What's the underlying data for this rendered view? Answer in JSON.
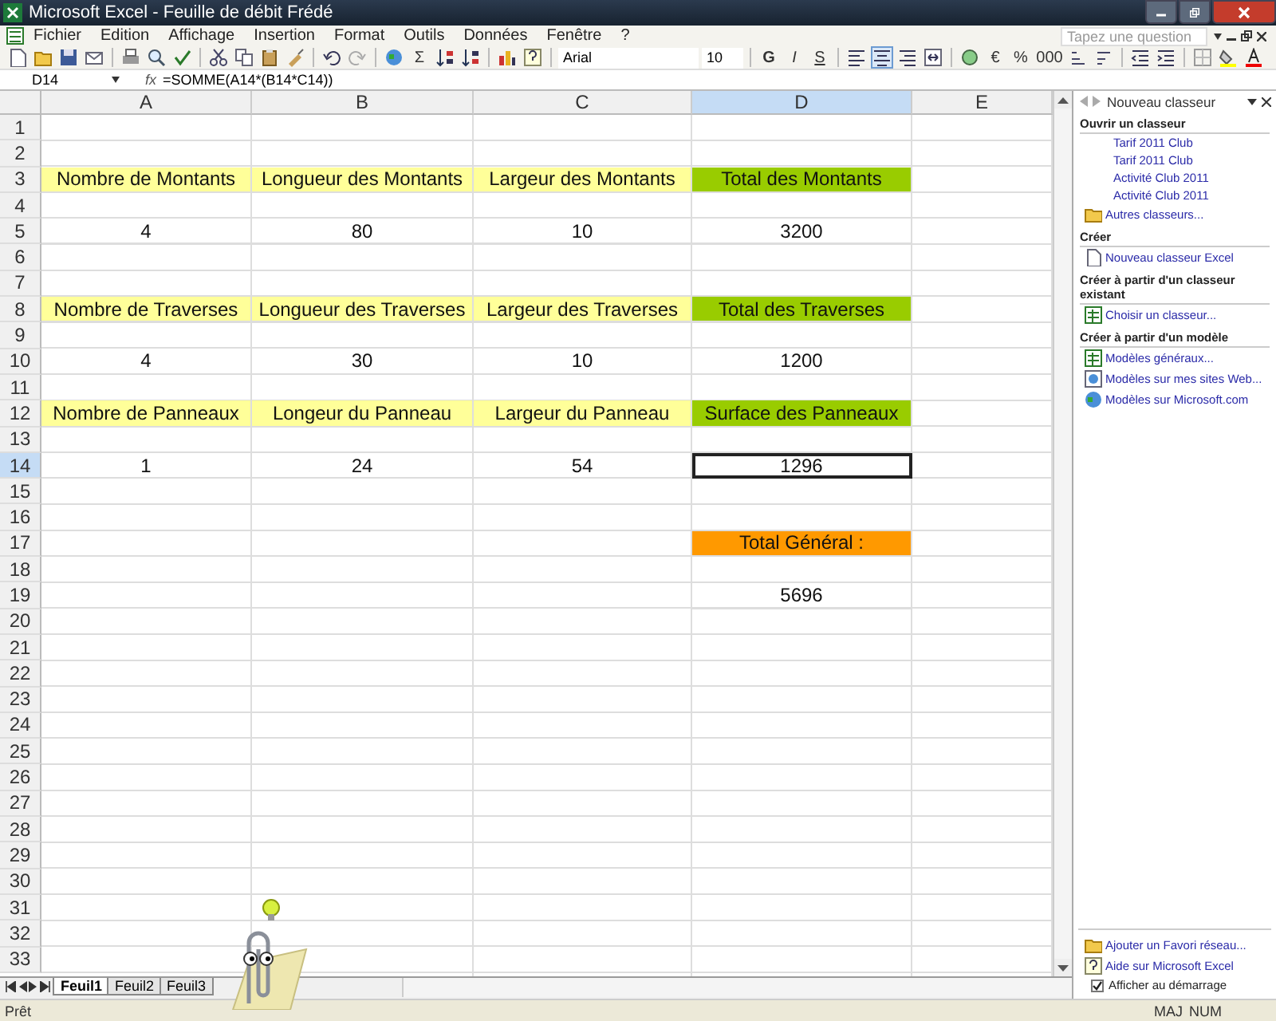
{
  "window": {
    "title": "Microsoft Excel - Feuille de débit Frédé"
  },
  "menu": [
    "Fichier",
    "Edition",
    "Affichage",
    "Insertion",
    "Format",
    "Outils",
    "Données",
    "Fenêtre",
    "?"
  ],
  "help_search": {
    "placeholder": "Tapez une question"
  },
  "toolbar": {
    "sum_button": "Σ",
    "font": "Arial",
    "size": "10",
    "style_buttons": [
      "G",
      "I",
      "S"
    ],
    "alignment_buttons": [
      {
        "selected": false
      },
      {
        "selected": true
      },
      {
        "selected": false
      }
    ],
    "number_buttons": [
      "€",
      "%",
      "000"
    ]
  },
  "formula_bar": {
    "name_box": "D14",
    "fx": "fx",
    "formula": "=SOMME(A14*(B14*C14))"
  },
  "sheet": {
    "columns": [
      {
        "label": "A",
        "selected": false
      },
      {
        "label": "B",
        "selected": false
      },
      {
        "label": "C",
        "selected": false
      },
      {
        "label": "D",
        "selected": true
      },
      {
        "label": "E",
        "selected": false
      }
    ],
    "rows": [
      {
        "label": "1",
        "selected": false
      },
      {
        "label": "2",
        "selected": false
      },
      {
        "label": "3",
        "selected": false,
        "cells": [
          {
            "text": "Nombre de Montants",
            "color": "#ffff99",
            "selected": false
          },
          {
            "text": "Longueur des Montants",
            "color": "#ffff99",
            "selected": false
          },
          {
            "text": "Largeur des Montants",
            "color": "#ffff99",
            "selected": false
          },
          {
            "text": "Total des Montants",
            "color": "#99cc00",
            "selected": false
          }
        ]
      },
      {
        "label": "4",
        "selected": false
      },
      {
        "label": "5",
        "selected": false,
        "cells": [
          {
            "text": "4",
            "selected": false
          },
          {
            "text": "80",
            "selected": false
          },
          {
            "text": "10",
            "selected": false
          },
          {
            "text": "3200",
            "selected": false
          }
        ]
      },
      {
        "label": "6",
        "selected": false
      },
      {
        "label": "7",
        "selected": false
      },
      {
        "label": "8",
        "selected": false,
        "cells": [
          {
            "text": "Nombre de Traverses",
            "color": "#ffff99",
            "selected": false
          },
          {
            "text": "Longueur des Traverses",
            "color": "#ffff99",
            "selected": false
          },
          {
            "text": "Largeur des Traverses",
            "color": "#ffff99",
            "selected": false
          },
          {
            "text": "Total des Traverses",
            "color": "#99cc00",
            "selected": false
          }
        ]
      },
      {
        "label": "9",
        "selected": false
      },
      {
        "label": "10",
        "selected": false,
        "cells": [
          {
            "text": "4",
            "selected": false
          },
          {
            "text": "30",
            "selected": false
          },
          {
            "text": "10",
            "selected": false
          },
          {
            "text": "1200",
            "selected": false
          }
        ]
      },
      {
        "label": "11",
        "selected": false
      },
      {
        "label": "12",
        "selected": false,
        "cells": [
          {
            "text": "Nombre de Panneaux",
            "color": "#ffff99",
            "selected": false
          },
          {
            "text": "Longeur du Panneau",
            "color": "#ffff99",
            "selected": false
          },
          {
            "text": "Largeur du Panneau",
            "color": "#ffff99",
            "selected": false
          },
          {
            "text": "Surface des Panneaux",
            "color": "#99cc00",
            "selected": false
          }
        ]
      },
      {
        "label": "13",
        "selected": false
      },
      {
        "label": "14",
        "selected": true,
        "cells": [
          {
            "text": "1",
            "selected": false
          },
          {
            "text": "24",
            "selected": false
          },
          {
            "text": "54",
            "selected": false
          },
          {
            "text": "1296",
            "selected": true
          }
        ]
      },
      {
        "label": "15",
        "selected": false
      },
      {
        "label": "16",
        "selected": false
      },
      {
        "label": "17",
        "selected": false,
        "cells": [
          null,
          null,
          null,
          {
            "text": "Total Général :",
            "color": "#ff9900",
            "selected": false
          }
        ]
      },
      {
        "label": "18",
        "selected": false
      },
      {
        "label": "19",
        "selected": false,
        "cells": [
          null,
          null,
          null,
          {
            "text": "5696",
            "selected": false
          }
        ]
      },
      {
        "label": "20",
        "selected": false
      },
      {
        "label": "21",
        "selected": false
      },
      {
        "label": "22",
        "selected": false
      },
      {
        "label": "23",
        "selected": false
      },
      {
        "label": "24",
        "selected": false
      },
      {
        "label": "25",
        "selected": false
      },
      {
        "label": "26",
        "selected": false
      },
      {
        "label": "27",
        "selected": false
      },
      {
        "label": "28",
        "selected": false
      },
      {
        "label": "29",
        "selected": false
      },
      {
        "label": "30",
        "selected": false
      },
      {
        "label": "31",
        "selected": false
      },
      {
        "label": "32",
        "selected": false
      },
      {
        "label": "33",
        "selected": false
      }
    ]
  },
  "sheet_tabs": [
    {
      "label": "Feuil1",
      "selected": true
    },
    {
      "label": "Feuil2",
      "selected": false
    },
    {
      "label": "Feuil3",
      "selected": false
    }
  ],
  "status_bar": {
    "status": "Prêt",
    "indicators": [
      "MAJ",
      "NUM"
    ]
  },
  "task_pane": {
    "title": "Nouveau classeur",
    "sections": [
      {
        "title": "Ouvrir un classeur",
        "items": [
          {
            "label": "Tarif 2011 Club",
            "kind": "plain"
          },
          {
            "label": "Tarif 2011 Club",
            "kind": "plain"
          },
          {
            "label": "Activité Club 2011",
            "kind": "plain"
          },
          {
            "label": "Activité Club 2011",
            "kind": "plain"
          },
          {
            "label": "Autres classeurs...",
            "kind": "folder"
          }
        ]
      },
      {
        "title": "Créer",
        "items": [
          {
            "label": "Nouveau classeur Excel",
            "kind": "page"
          }
        ]
      },
      {
        "title": "Créer à partir d'un classeur existant",
        "items": [
          {
            "label": "Choisir un classeur...",
            "kind": "sheet"
          }
        ]
      },
      {
        "title": "Créer à partir d'un modèle",
        "items": [
          {
            "label": "Modèles généraux...",
            "kind": "sheet"
          },
          {
            "label": "Modèles sur mes sites Web...",
            "kind": "web"
          },
          {
            "label": "Modèles sur Microsoft.com",
            "kind": "globe"
          }
        ]
      }
    ],
    "footer_links": [
      {
        "label": "Ajouter un Favori réseau...",
        "kind": "folder"
      },
      {
        "label": "Aide sur Microsoft Excel",
        "kind": "help"
      }
    ],
    "startup_checkbox": {
      "label": "Afficher au démarrage",
      "checked": true
    }
  }
}
